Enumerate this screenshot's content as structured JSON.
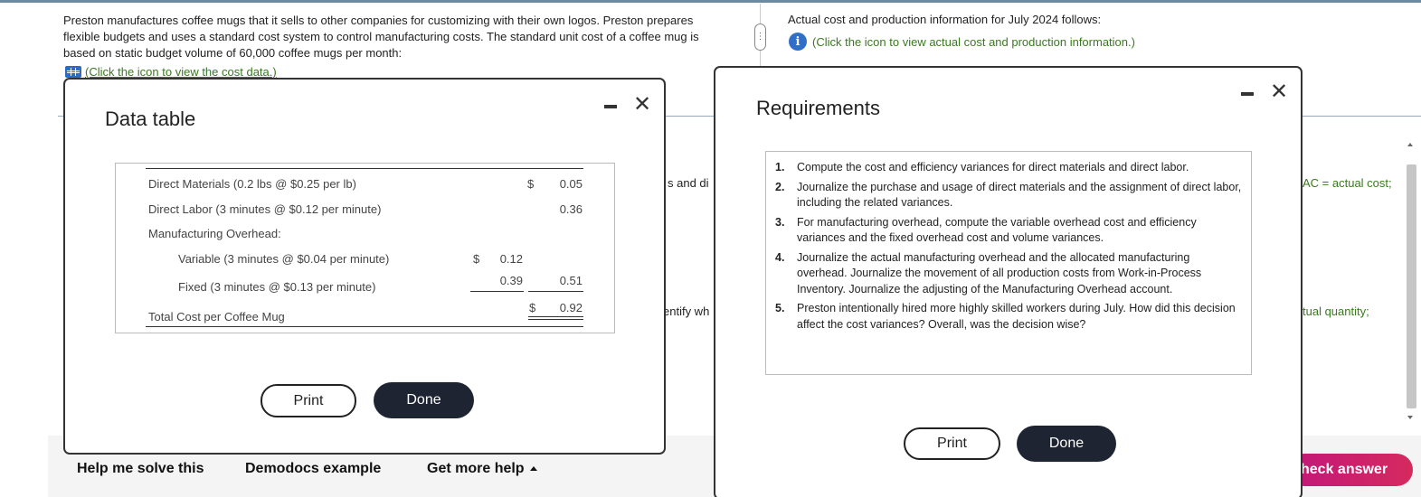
{
  "background": {
    "intro_text": "Preston manufactures coffee mugs that it sells to other companies for customizing with their own logos. Preston prepares flexible budgets and uses a standard cost system to control manufacturing costs. The standard unit cost of a coffee mug is based on static budget volume of 60,000 coffee mugs per month:",
    "cost_link": "(Click the icon to view the cost data.)",
    "actual_intro": "Actual cost and production information for July 2024 follows:",
    "actual_link": "(Click the icon to view actual cost and production information.)",
    "peek_left_1": "s and di",
    "peek_left_2": "entify wh",
    "peek_right_1": "AC = actual cost;",
    "peek_right_2": "tual quantity;"
  },
  "bottom_bar": {
    "help": "Help me solve this",
    "demodocs": "Demodocs example",
    "more_help": "Get more help",
    "check_answer": "heck answer"
  },
  "data_table": {
    "title": "Data table",
    "rows": {
      "dm_label": "Direct Materials (0.2 lbs @ $0.25 per lb)",
      "dm_dollar": "$",
      "dm_value": "0.05",
      "dl_label": "Direct Labor (3 minutes @ $0.12 per minute)",
      "dl_value": "0.36",
      "moh_label": "Manufacturing Overhead:",
      "var_label": "Variable (3 minutes @ $0.04 per minute)",
      "var_dollar": "$",
      "var_value": "0.12",
      "fix_label": "Fixed (3 minutes @ $0.13 per minute)",
      "fix_value": "0.39",
      "moh_total": "0.51",
      "total_label": "Total Cost per Coffee Mug",
      "total_dollar": "$",
      "total_value": "0.92"
    },
    "print": "Print",
    "done": "Done"
  },
  "requirements": {
    "title": "Requirements",
    "items": [
      {
        "num": "1.",
        "text": "Compute the cost and efficiency variances for direct materials and direct labor."
      },
      {
        "num": "2.",
        "text": "Journalize the purchase and usage of direct materials and the assignment of direct labor, including the related variances."
      },
      {
        "num": "3.",
        "text": "For manufacturing overhead, compute the variable overhead cost and efficiency variances and the fixed overhead cost and volume variances."
      },
      {
        "num": "4.",
        "text": "Journalize the actual manufacturing overhead and the allocated manufacturing overhead. Journalize the movement of all production costs from Work-in-Process Inventory. Journalize the adjusting of the Manufacturing Overhead account."
      },
      {
        "num": "5.",
        "text": "Preston intentionally hired more highly skilled workers during July. How did this decision affect the cost variances? Overall, was the decision wise?"
      }
    ],
    "print": "Print",
    "done": "Done"
  }
}
